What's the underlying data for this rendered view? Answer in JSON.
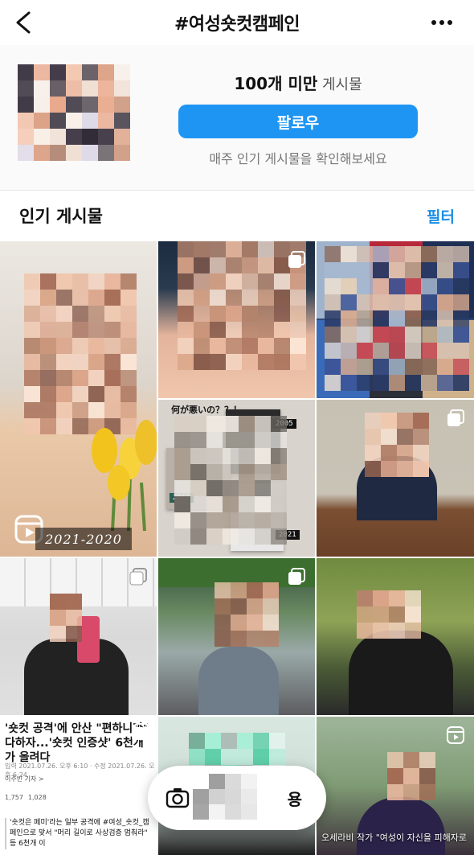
{
  "header": {
    "title": "#여성숏컷캠페인",
    "back_icon": "chevron-left-icon",
    "more_icon": "more-horizontal-icon"
  },
  "profile": {
    "count_bold": "100개 미만",
    "count_suffix": " 게시물",
    "follow_label": "팔로우",
    "hint": "매주 인기 게시물을 확인해보세요"
  },
  "section": {
    "title": "인기 게시물",
    "filter_label": "필터"
  },
  "tiles": {
    "t1": {
      "year_label": "2021-2020"
    },
    "t3_collage": {
      "heading": "何が悪いの？？！",
      "tag_2005": "2005",
      "tag_2013": "2013",
      "tag_2021": "2021"
    },
    "t7_article": {
      "headline": "'숏컷 공격'에 안산 \"편하니까\" 다하자...'숏컷 인증샷' 6천개가 올려다",
      "meta": "입력 2021.07.26. 오후 6:10 · 수정 2021.07.26. 오후 6:24",
      "author": "이주빈 기자 >",
      "react_count_1": "1,757",
      "react_count_2": "1,028",
      "quote": "'숏컷은 페미'라는 일부 공격에 #여성_숏컷_캠페인으로 맞서 \"머리 길이로 사상검증 멈춰라\" 등 6천개 이"
    },
    "t9_caption": "오세라비 작가 \"여성이 자신을 피해자로"
  },
  "floating": {
    "camera_icon": "camera-icon",
    "label": "용"
  },
  "colors": {
    "accent": "#1e95f3",
    "filter": "#1a8fe6"
  }
}
